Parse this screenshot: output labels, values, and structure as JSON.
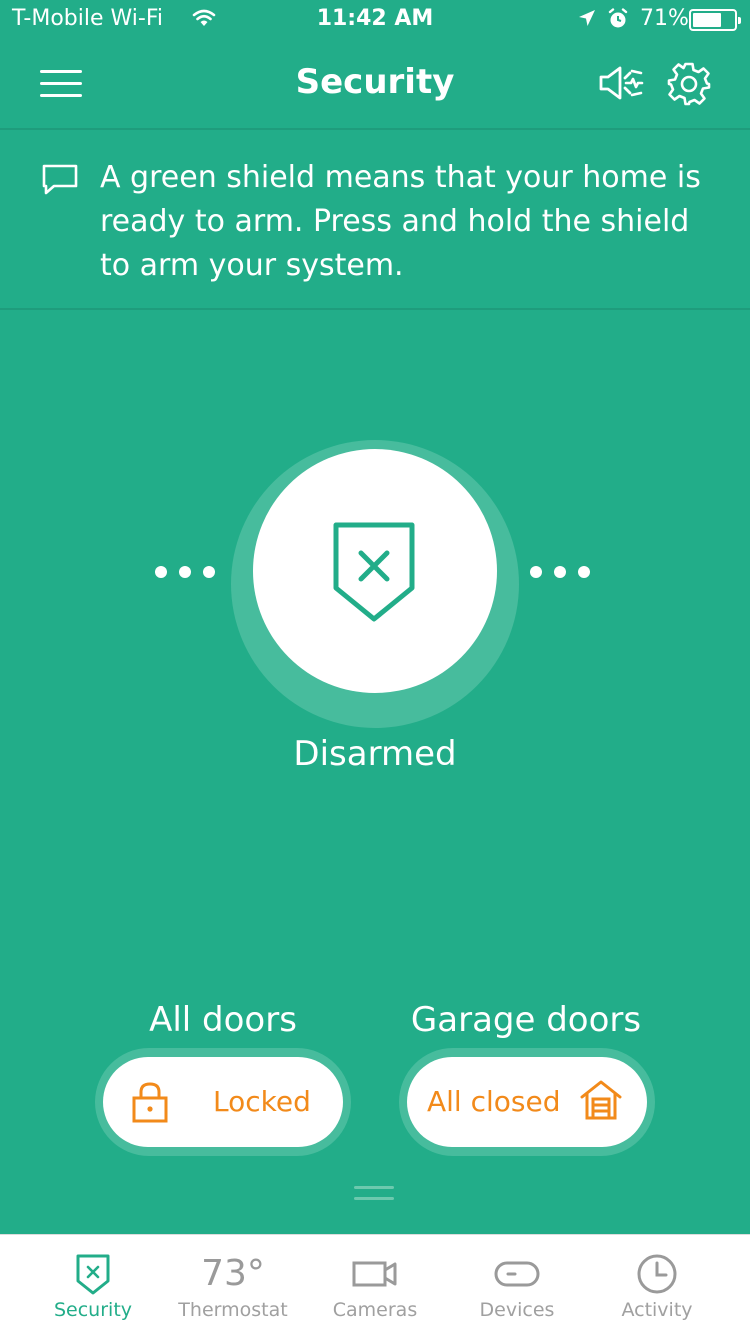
{
  "status_bar": {
    "carrier": "T-Mobile Wi-Fi",
    "time": "11:42 AM",
    "battery_percent": "71%",
    "battery_level": 0.71,
    "icons": [
      "wifi-icon",
      "location-arrow-icon",
      "alarm-clock-icon",
      "battery-icon"
    ]
  },
  "header": {
    "title": "Security",
    "icons": [
      "menu-icon",
      "speaker-icon",
      "gear-icon"
    ]
  },
  "tip": {
    "text": "A green shield means that your home is ready to arm. Press and hold the shield to arm your system.",
    "icon": "chat-bubble-icon"
  },
  "security": {
    "state": "Disarmed",
    "icon": "shield-x-icon"
  },
  "locks": {
    "doors": {
      "title": "All doors",
      "status": "Locked",
      "icon": "padlock-icon"
    },
    "garage": {
      "title": "Garage doors",
      "status": "All closed",
      "icon": "garage-icon"
    }
  },
  "tabs": [
    {
      "label": "Security",
      "icon": "shield-x-icon",
      "active": true
    },
    {
      "label": "Thermostat",
      "value": "73°",
      "active": false
    },
    {
      "label": "Cameras",
      "icon": "camera-icon",
      "active": false
    },
    {
      "label": "Devices",
      "icon": "device-icon",
      "active": false
    },
    {
      "label": "Activity",
      "icon": "clock-icon",
      "active": false
    }
  ],
  "colors": {
    "brand_green": "#22ad89",
    "accent_orange": "#f28a1a",
    "inactive_gray": "#a0a0a0"
  }
}
